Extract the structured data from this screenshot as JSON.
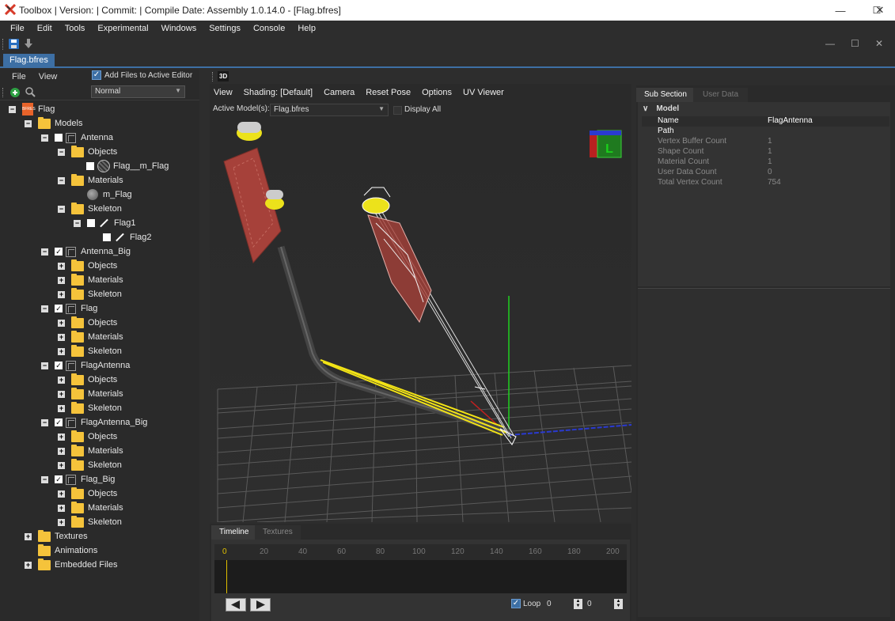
{
  "window": {
    "title": "Toolbox | Version:  | Commit:  | Compile Date:  Assembly 1.0.14.0 - [Flag.bfres]",
    "minimize_glyph": "—",
    "maximize_glyph": "☐",
    "close_glyph": "✕"
  },
  "menu": [
    "File",
    "Edit",
    "Tools",
    "Experimental",
    "Windows",
    "Settings",
    "Console",
    "Help"
  ],
  "toolbar": {
    "save_icon": "save-icon",
    "download_icon": "download-arrow-icon"
  },
  "mdi": {
    "minimize": "—",
    "maximize": "☐",
    "close": "✕"
  },
  "file_tab": "Flag.bfres",
  "left_panel": {
    "menu": [
      "File",
      "View"
    ],
    "add_files_label": "Add Files to Active Editor",
    "add_files_checked": true,
    "filter_value": "Normal",
    "tree": {
      "root": "Flag",
      "models": "Models",
      "antenna": "Antenna",
      "objects": "Objects",
      "flag_m_flag": "Flag__m_Flag",
      "materials": "Materials",
      "m_flag": "m_Flag",
      "skeleton": "Skeleton",
      "flag1": "Flag1",
      "flag2": "Flag2",
      "antenna_big": "Antenna_Big",
      "flag": "Flag",
      "flag_antenna": "FlagAntenna",
      "flag_antenna_big": "FlagAntenna_Big",
      "flag_big": "Flag_Big",
      "textures": "Textures",
      "animations": "Animations",
      "embedded_files": "Embedded Files"
    }
  },
  "viewer": {
    "tab_label": "3D",
    "menu": [
      "View",
      "Shading: [Default]",
      "Camera",
      "Reset Pose",
      "Options",
      "UV Viewer"
    ],
    "active_models_label": "Active Model(s):",
    "active_model_value": "Flag.bfres",
    "display_all_label": "Display All",
    "gizmo_label": "L"
  },
  "timeline": {
    "tabs": [
      "Timeline",
      "Textures"
    ],
    "ticks": [
      "0",
      "20",
      "40",
      "60",
      "80",
      "100",
      "120",
      "140",
      "160",
      "180",
      "200"
    ],
    "loop_label": "Loop",
    "loop_checked": true,
    "frame_value": "0",
    "end_value": "0"
  },
  "properties": {
    "tabs": [
      "Sub Section",
      "User Data"
    ],
    "section": "Model",
    "rows": [
      {
        "key": "Name",
        "value": "FlagAntenna"
      },
      {
        "key": "Path",
        "value": ""
      },
      {
        "key": "Vertex Buffer Count",
        "value": "1"
      },
      {
        "key": "Shape Count",
        "value": "1"
      },
      {
        "key": "Material Count",
        "value": "1"
      },
      {
        "key": "User Data Count",
        "value": "0"
      },
      {
        "key": "Total Vertex Count",
        "value": "754"
      }
    ]
  },
  "colors": {
    "accent": "#3d6fa4",
    "folder": "#f5c33b",
    "flag_red": "#b04a42",
    "wire_yellow": "#f2e316"
  }
}
